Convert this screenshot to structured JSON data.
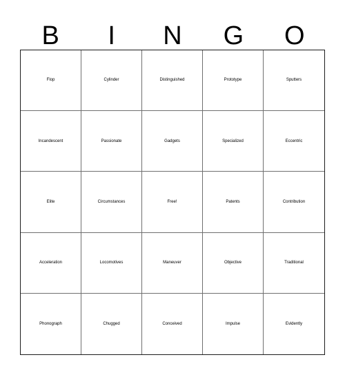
{
  "card": {
    "title": "Bingo Card",
    "header_letters": [
      "B",
      "I",
      "N",
      "G",
      "O"
    ],
    "colors": {
      "background": "#ffffff",
      "text": "#000000",
      "grid_line": "#6f6f6f",
      "outer_border": "#1a1a1a"
    },
    "grid": {
      "columns": 5,
      "rows": 5,
      "free_space_index": 12
    },
    "cells": [
      {
        "label": "Flop",
        "size": "xl"
      },
      {
        "label": "Cylinder",
        "size": "md"
      },
      {
        "label": "Distinguished",
        "size": "xs"
      },
      {
        "label": "Prototype",
        "size": "md"
      },
      {
        "label": "Sputters",
        "size": "md"
      },
      {
        "label": "Incandescent",
        "size": "xs"
      },
      {
        "label": "Passionate",
        "size": "sm"
      },
      {
        "label": "Gadgets",
        "size": "md"
      },
      {
        "label": "Specialized",
        "size": "sm"
      },
      {
        "label": "Eccentric",
        "size": "md"
      },
      {
        "label": "Elite",
        "size": "xl"
      },
      {
        "label": "Circumstances",
        "size": "xs"
      },
      {
        "label": "Free!",
        "size": "xl"
      },
      {
        "label": "Patents",
        "size": "md"
      },
      {
        "label": "Contribution",
        "size": "sm"
      },
      {
        "label": "Acceleration",
        "size": "sm"
      },
      {
        "label": "Locomotives",
        "size": "sm"
      },
      {
        "label": "Maneuver",
        "size": "md"
      },
      {
        "label": "Objective",
        "size": "md"
      },
      {
        "label": "Traditional",
        "size": "sm"
      },
      {
        "label": "Phonograph",
        "size": "sm"
      },
      {
        "label": "Chugged",
        "size": "md"
      },
      {
        "label": "Conceived",
        "size": "md"
      },
      {
        "label": "Impulse",
        "size": "md"
      },
      {
        "label": "Evidently",
        "size": "md"
      }
    ]
  }
}
